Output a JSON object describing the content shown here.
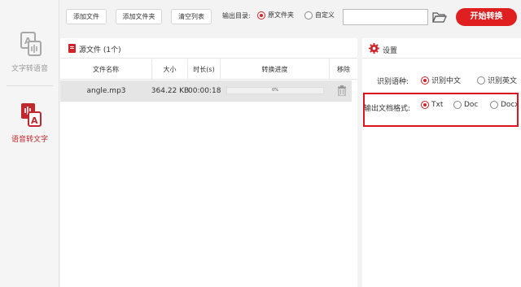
{
  "sidebar": {
    "items": [
      {
        "label": "文字转语音",
        "active": false
      },
      {
        "label": "语音转文字",
        "active": true
      }
    ]
  },
  "toolbar": {
    "add_file": "添加文件",
    "add_folder": "添加文件夹",
    "clear_list": "清空列表",
    "output_dir_label": "输出目录:",
    "output_options": [
      {
        "label": "原文件夹",
        "selected": true
      },
      {
        "label": "自定义",
        "selected": false
      }
    ],
    "path_value": "",
    "start_button": "开始转换"
  },
  "file_panel": {
    "title": "源文件 (1个)",
    "columns": [
      "文件名称",
      "大小",
      "时长(s)",
      "转换进度",
      "移除"
    ],
    "rows": [
      {
        "name": "angle.mp3",
        "size": "364.22 KB",
        "duration": "00:00:18",
        "progress": "0%"
      }
    ]
  },
  "settings": {
    "title": "设置",
    "language_label": "识别语种:",
    "language_options": [
      {
        "label": "识别中文",
        "selected": true
      },
      {
        "label": "识别英文",
        "selected": false
      }
    ],
    "format_label": "输出文档格式:",
    "format_options": [
      {
        "label": "Txt",
        "selected": true
      },
      {
        "label": "Doc",
        "selected": false
      },
      {
        "label": "Docx",
        "selected": false
      }
    ]
  },
  "colors": {
    "accent": "#e02020",
    "highlight_border": "#e0141b"
  }
}
